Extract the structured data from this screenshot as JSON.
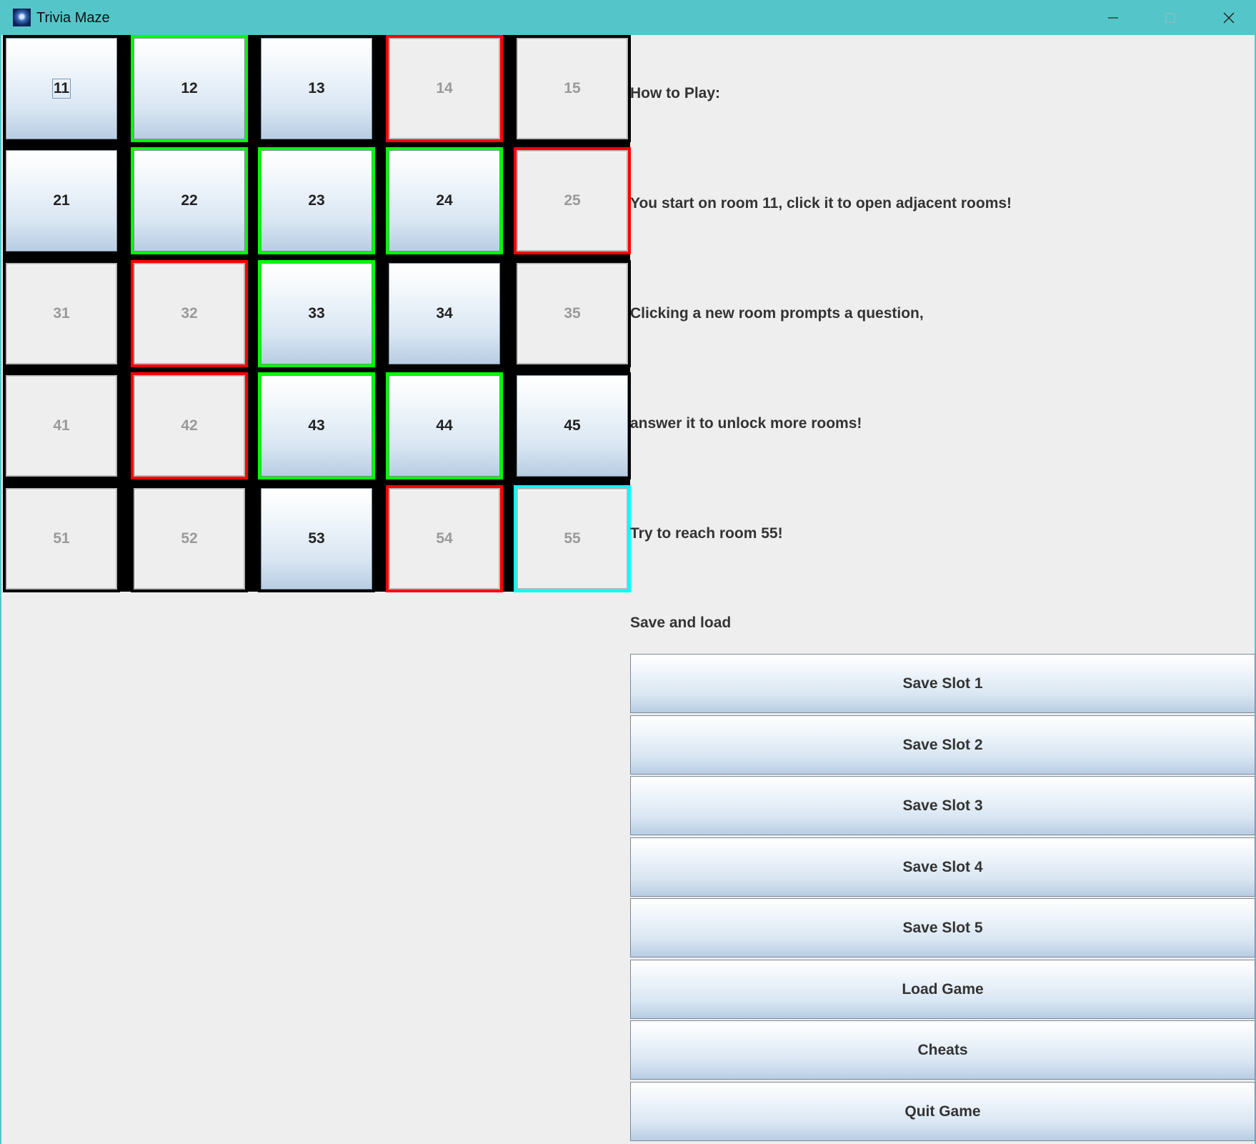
{
  "window": {
    "title": "Trivia Maze",
    "accent": "#54c6c9"
  },
  "maze": {
    "colors": {
      "wall": "#000000",
      "open_door": "#00ff00",
      "locked_door": "#ff0000",
      "exit": "#00ffff"
    },
    "rooms": [
      {
        "label": "11",
        "state": "open",
        "focused": true
      },
      {
        "label": "12",
        "state": "open"
      },
      {
        "label": "13",
        "state": "open"
      },
      {
        "label": "14",
        "state": "locked"
      },
      {
        "label": "15",
        "state": "locked"
      },
      {
        "label": "21",
        "state": "open"
      },
      {
        "label": "22",
        "state": "open"
      },
      {
        "label": "23",
        "state": "open"
      },
      {
        "label": "24",
        "state": "open"
      },
      {
        "label": "25",
        "state": "locked"
      },
      {
        "label": "31",
        "state": "locked"
      },
      {
        "label": "32",
        "state": "locked"
      },
      {
        "label": "33",
        "state": "open"
      },
      {
        "label": "34",
        "state": "open"
      },
      {
        "label": "35",
        "state": "locked"
      },
      {
        "label": "41",
        "state": "locked"
      },
      {
        "label": "42",
        "state": "locked"
      },
      {
        "label": "43",
        "state": "open"
      },
      {
        "label": "44",
        "state": "open"
      },
      {
        "label": "45",
        "state": "open"
      },
      {
        "label": "51",
        "state": "locked"
      },
      {
        "label": "52",
        "state": "locked"
      },
      {
        "label": "53",
        "state": "open"
      },
      {
        "label": "54",
        "state": "locked"
      },
      {
        "label": "55",
        "state": "locked"
      }
    ]
  },
  "instructions": {
    "heading": "How to Play:",
    "line1": "You start on room 11, click it to open adjacent rooms!",
    "line2": "Clicking a new room prompts a question,",
    "line3": "answer it to unlock more rooms!",
    "line4": "Try to reach room 55!"
  },
  "save_load": {
    "heading": "Save and load",
    "buttons": [
      "Save Slot 1",
      "Save Slot 2",
      "Save Slot 3",
      "Save Slot 4",
      "Save Slot 5",
      "Load Game",
      "Cheats",
      "Quit Game"
    ]
  }
}
